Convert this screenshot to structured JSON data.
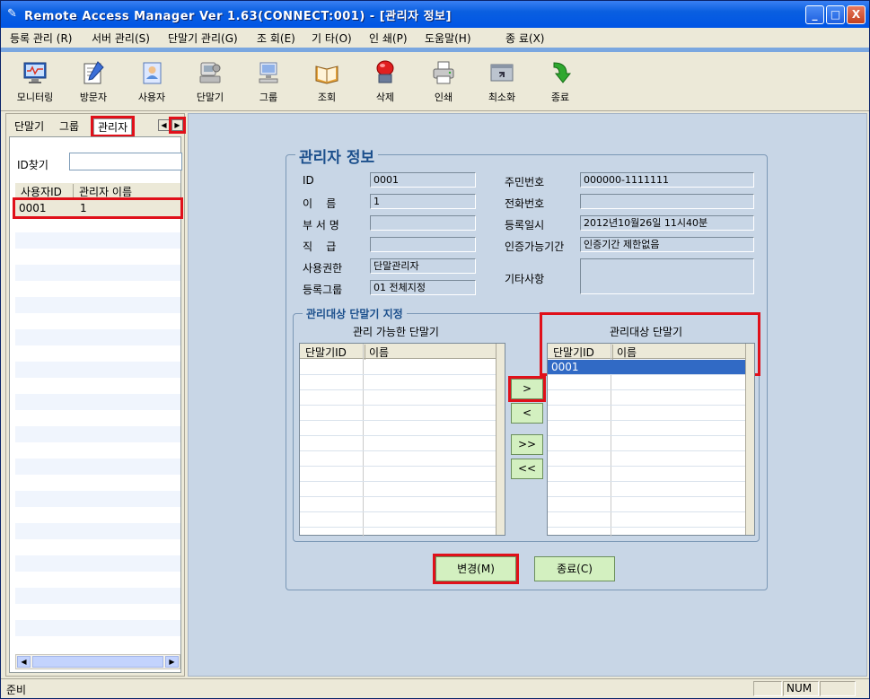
{
  "window": {
    "title": "Remote Access Manager Ver 1.63(CONNECT:001) - [관리자 정보]",
    "min": "_",
    "max": "□",
    "close": "X"
  },
  "menu": [
    "등록 관리 (R)",
    "서버 관리(S)",
    "단말기 관리(G)",
    "조 회(E)",
    "기 타(O)",
    "인 쇄(P)",
    "도움말(H)",
    "종 료(X)"
  ],
  "toolbar": [
    {
      "label": "모니터링",
      "icon": "monitor-icon"
    },
    {
      "label": "방문자",
      "icon": "visitor-pen-icon"
    },
    {
      "label": "사용자",
      "icon": "user-card-icon"
    },
    {
      "label": "단말기",
      "icon": "terminal-icon"
    },
    {
      "label": "그룹",
      "icon": "group-pc-icon"
    },
    {
      "label": "조회",
      "icon": "book-icon"
    },
    {
      "label": "삭제",
      "icon": "delete-icon"
    },
    {
      "label": "인쇄",
      "icon": "printer-icon"
    },
    {
      "label": "최소화",
      "icon": "minimize-icon"
    },
    {
      "label": "종료",
      "icon": "exit-arrow-icon"
    }
  ],
  "left": {
    "tabs": [
      "단말기",
      "그룹",
      "관리자"
    ],
    "find_label": "ID찾기",
    "find_value": "",
    "columns": [
      "사용자ID",
      "관리자 이름"
    ],
    "rows": [
      {
        "id": "0001",
        "name": "1"
      }
    ]
  },
  "form": {
    "legend": "관리자 정보",
    "labels": {
      "id": "ID",
      "name": "이    름",
      "dept": "부 서 명",
      "rank": "직    급",
      "perm": "사용권한",
      "group": "등록그룹",
      "ssn": "주민번호",
      "phone": "전화번호",
      "regdate": "등록일시",
      "authperiod": "인증가능기간",
      "etc": "기타사항"
    },
    "values": {
      "id": "0001",
      "name": "1",
      "dept": "",
      "rank": "",
      "perm": "단말관리자",
      "group": "01 전체지정",
      "ssn": "000000-1111111",
      "phone": "",
      "regdate": "2012년10월26일  11시40분",
      "authperiod": "인증기간 제한없음",
      "etc": ""
    },
    "assign": {
      "legend": "관리대상 단말기 지정",
      "available_title": "관리 가능한 단말기",
      "managed_title": "관리대상 단말기",
      "columns": [
        "단말기ID",
        "이름"
      ],
      "available_rows": [],
      "managed_rows": [
        {
          "id": "0001",
          "name": ""
        }
      ],
      "btn_add": ">",
      "btn_remove": "<",
      "btn_add_all": ">>",
      "btn_remove_all": "<<"
    },
    "btn_change": "변경(M)",
    "btn_close": "종료(C)"
  },
  "status": {
    "text": "준비",
    "num": "NUM"
  }
}
